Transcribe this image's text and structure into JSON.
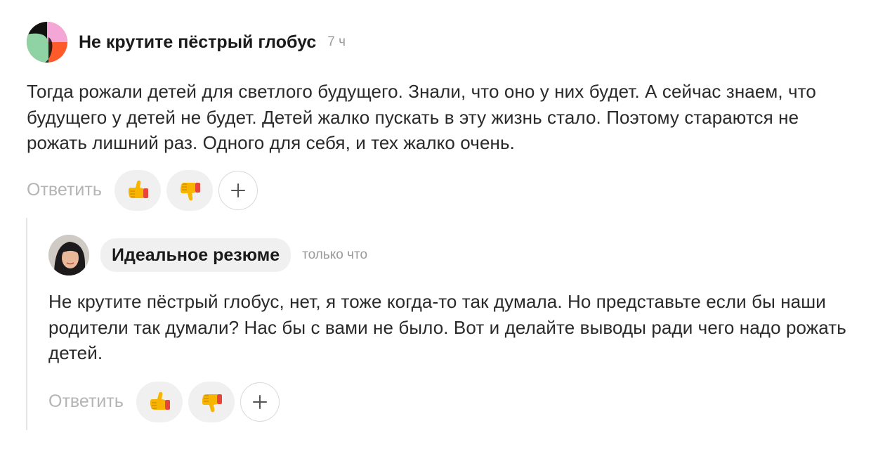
{
  "comment": {
    "author": "Не крутите пёстрый глобус",
    "time": "7 ч",
    "text": "Тогда рожали детей для светлого будущего. Знали, что оно у них будет. А сейчас знаем, что будущего у детей не будет. Детей жалко пускать в эту жизнь стало. Поэтому стараются не рожать лишний раз. Одного для себя, и тех жалко очень.",
    "actions": {
      "reply_label": "Ответить",
      "like_icon": "thumbs-up-icon",
      "dislike_icon": "thumbs-down-icon",
      "add_icon": "plus-icon"
    }
  },
  "reply": {
    "author": "Идеальное резюме",
    "time": "только что",
    "text": "Не крутите пёстрый глобус, нет, я тоже когда-то так думала. Но представьте если бы наши родители так думали? Нас бы с вами не было. Вот и делайте выводы ради чего надо рожать детей.",
    "actions": {
      "reply_label": "Ответить",
      "like_icon": "thumbs-up-icon",
      "dislike_icon": "thumbs-down-icon",
      "add_icon": "plus-icon"
    }
  },
  "colors": {
    "muted_text": "#b4b4b4",
    "time_text": "#9a9a9a",
    "pill_bg": "#f0f0f0",
    "emoji_yellow": "#f7b500",
    "emoji_red": "#e8463a"
  }
}
